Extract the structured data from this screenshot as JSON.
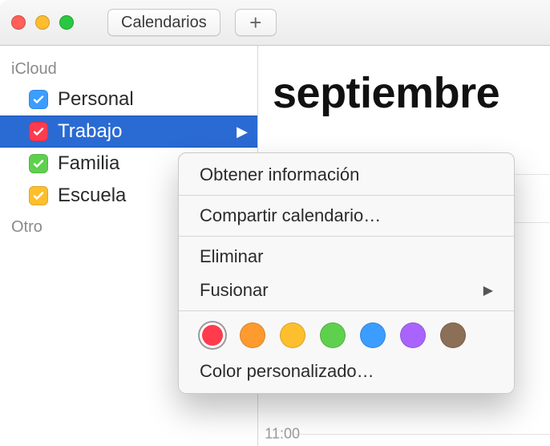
{
  "toolbar": {
    "calendars_label": "Calendarios",
    "add_label": "+"
  },
  "sidebar": {
    "groups": [
      {
        "name": "iCloud",
        "items": [
          {
            "label": "Personal",
            "color": "#3b9dff",
            "checked": true,
            "selected": false
          },
          {
            "label": "Trabajo",
            "color": "#ff3b4d",
            "checked": true,
            "selected": true
          },
          {
            "label": "Familia",
            "color": "#5fd04e",
            "checked": true,
            "selected": false
          },
          {
            "label": "Escuela",
            "color": "#fdbf2d",
            "checked": true,
            "selected": false
          }
        ]
      },
      {
        "name": "Otro",
        "items": []
      }
    ]
  },
  "main": {
    "month_title": "septiembre",
    "time_label": "11:00"
  },
  "context_menu": {
    "items": {
      "get_info": "Obtener información",
      "share": "Compartir calendario…",
      "delete": "Eliminar",
      "merge": "Fusionar",
      "custom_color": "Color personalizado…"
    },
    "swatches": [
      "#ff3b4d",
      "#ff9a2f",
      "#fdbf2d",
      "#5fd04e",
      "#3b9dff",
      "#a964ff",
      "#8b6f56"
    ],
    "selected_swatch_index": 0
  }
}
